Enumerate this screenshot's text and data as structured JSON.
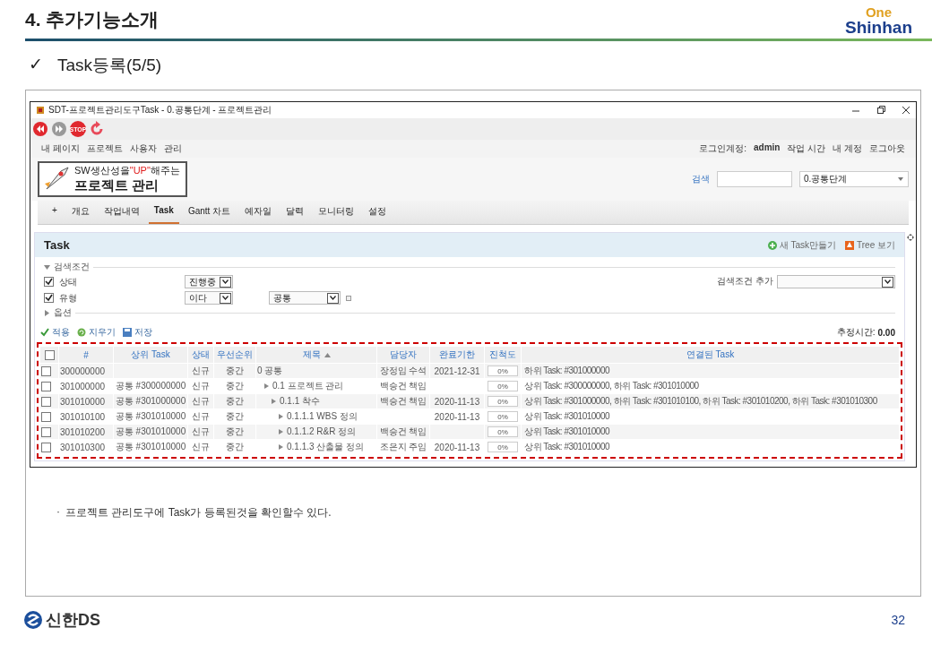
{
  "slide": {
    "title": "4. 추가기능소개",
    "logo": {
      "top": "One",
      "bottom": "Shinhan"
    },
    "subtitle": {
      "check": "✓",
      "text": "Task등록(5/5)"
    },
    "note": {
      "bullet": "·",
      "text": "프로젝트 관리도구에 Task가 등록된것을 확인할수 있다."
    },
    "footer": {
      "company": "신한DS",
      "page": "32"
    }
  },
  "app": {
    "window_title": "SDT-프로젝트관리도구Task - 0.공통단계 - 프로젝트관리",
    "toolbar": [
      {
        "kind": "back"
      },
      {
        "kind": "forward"
      },
      {
        "kind": "stop",
        "label": "STOP"
      },
      {
        "kind": "refresh"
      }
    ],
    "top_menu": [
      "내 페이지",
      "프로젝트",
      "사용자",
      "관리"
    ],
    "account": {
      "label": "로그인계정:",
      "user": "admin",
      "links": [
        "작업 시간",
        "내 계정",
        "로그아웃"
      ]
    },
    "banner": {
      "before": "SW생산성을",
      "highlight": "\"UP\"",
      "after": "해주는",
      "title": "프로젝트 관리"
    },
    "search": {
      "label": "검색",
      "project": "0.공통단계"
    },
    "tabs": [
      {
        "label": "+",
        "selected": false
      },
      {
        "label": "개요",
        "selected": false
      },
      {
        "label": "작업내역",
        "selected": false
      },
      {
        "label": "Task",
        "selected": true
      },
      {
        "label": "Gantt 차트",
        "selected": false
      },
      {
        "label": "예자일",
        "selected": false
      },
      {
        "label": "달력",
        "selected": false
      },
      {
        "label": "모니터링",
        "selected": false
      },
      {
        "label": "설정",
        "selected": false
      }
    ],
    "panel": {
      "title": "Task",
      "actions": [
        {
          "kind": "add",
          "label": "새 Task만들기"
        },
        {
          "kind": "tree",
          "label": "Tree 보기"
        }
      ],
      "filters": {
        "legend": "검색조건",
        "expanded": true,
        "rows": [
          {
            "label": "상태",
            "checked": true,
            "operator": "진행중"
          },
          {
            "label": "유형",
            "checked": true,
            "operator": "이다",
            "value": "공통"
          }
        ],
        "add_label": "검색조건 추가"
      },
      "options": {
        "legend": "옵션",
        "expanded": false
      },
      "buttons": [
        {
          "kind": "apply",
          "label": "적용"
        },
        {
          "kind": "clear",
          "label": "지우기"
        },
        {
          "kind": "save",
          "label": "저장"
        }
      ],
      "estimate": {
        "label": "추정시간:",
        "value": "0.00"
      },
      "table": {
        "all_checked": false,
        "columns": [
          {
            "label": "#"
          },
          {
            "label": "상위 Task"
          },
          {
            "label": "상태"
          },
          {
            "label": "우선순위"
          },
          {
            "label": "제목",
            "sort_ascending": true
          },
          {
            "label": "담당자"
          },
          {
            "label": "완료기한"
          },
          {
            "label": "진척도"
          },
          {
            "label": "연결된 Task"
          }
        ],
        "rows": [
          {
            "id": "300000000",
            "status": "신규",
            "priority": "중간",
            "title": "0 공통",
            "assignee": "장정임 수석",
            "due": "2021-12-31",
            "progress": "0%",
            "level": 0,
            "linked": "하위 Task: #301000000",
            "checked": false,
            "children": [
              {
                "id": "301000000",
                "parent": "공통 #300000000",
                "status": "신규",
                "priority": "중간",
                "title": "0.1 프로젝트 관리",
                "assignee": "백승건 책임",
                "progress": "0%",
                "level": 0,
                "linked": "상위 Task: #300000000, 하위 Task: #301010000",
                "checked": false,
                "children": [
                  {
                    "id": "301010000",
                    "parent": "공통 #301000000",
                    "status": "신규",
                    "priority": "중간",
                    "title": "0.1.1 착수",
                    "assignee": "백승건 책임",
                    "due": "2020-11-13",
                    "progress": "0%",
                    "level": 0,
                    "linked": "상위 Task: #301000000, 하위 Task: #301010100, 하위 Task: #301010200, 하위 Task: #301010300",
                    "checked": false,
                    "children": [
                      {
                        "id": "301010100",
                        "parent": "공통 #301010000",
                        "status": "신규",
                        "priority": "중간",
                        "title": "0.1.1.1 WBS 정의",
                        "due": "2020-11-13",
                        "progress": "0%",
                        "level": 0,
                        "linked": "상위 Task: #301010000",
                        "checked": false
                      },
                      {
                        "id": "301010200",
                        "parent": "공통 #301010000",
                        "status": "신규",
                        "priority": "중간",
                        "title": "0.1.1.2 R&R 정의",
                        "assignee": "백승건 책임",
                        "progress": "0%",
                        "level": 0,
                        "linked": "상위 Task: #301010000",
                        "checked": false
                      },
                      {
                        "id": "301010300",
                        "parent": "공통 #301010000",
                        "status": "신규",
                        "priority": "중간",
                        "title": "0.1.1.3 산출물 정의",
                        "assignee": "조은지 주임",
                        "due": "2020-11-13",
                        "progress": "0%",
                        "level": 0,
                        "linked": "상위 Task: #301010000",
                        "checked": false
                      }
                    ]
                  }
                ]
              }
            ]
          }
        ]
      }
    }
  }
}
